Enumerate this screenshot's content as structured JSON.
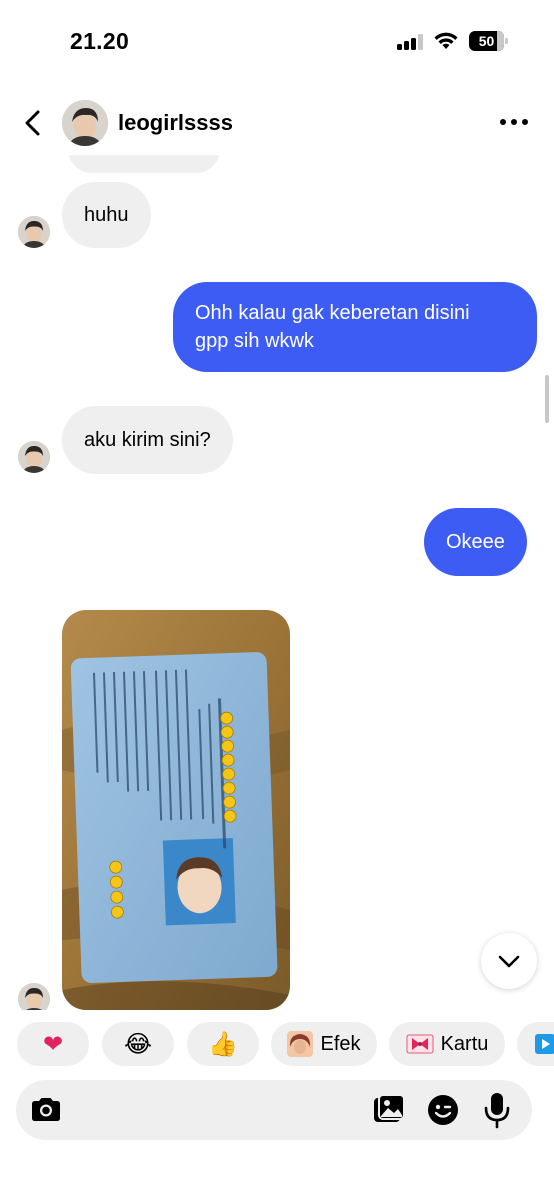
{
  "status_bar": {
    "time": "21.20",
    "battery": "50",
    "battery_level": 0.5,
    "signal_bars": 3
  },
  "header": {
    "username": "leogirlssss",
    "back_icon": "chevron-left-icon",
    "more_icon": "more-horizontal-icon"
  },
  "messages": [
    {
      "direction": "incoming",
      "text": "huhu"
    },
    {
      "direction": "outgoing",
      "text": "Ohh kalau gak keberetan disini gpp sih wkwk"
    },
    {
      "direction": "incoming",
      "text": "aku kirim sini?"
    },
    {
      "direction": "outgoing",
      "text": "Okeee"
    },
    {
      "direction": "incoming",
      "type": "photo",
      "description_icon": "id-card-photo"
    }
  ],
  "message_lines": {
    "m1": "huhu",
    "m2_line1": "Ohh kalau gak keberetan disini",
    "m2_line2": "gpp sih wkwk",
    "m3": "aku kirim sini?",
    "m4": "Okeee"
  },
  "reactions": {
    "heart": "❤",
    "laugh": "😂",
    "thumbs": "👍",
    "effects_label": "Efek",
    "card_label": "Kartu"
  },
  "composer": {
    "placeholder": "",
    "icons": [
      "camera-icon",
      "gallery-icon",
      "sticker-icon",
      "microphone-icon"
    ]
  },
  "colors": {
    "outgoing_bubble": "#3d5cf4",
    "incoming_bubble": "#efefef",
    "background": "#ffffff",
    "heart": "#e0245e"
  }
}
